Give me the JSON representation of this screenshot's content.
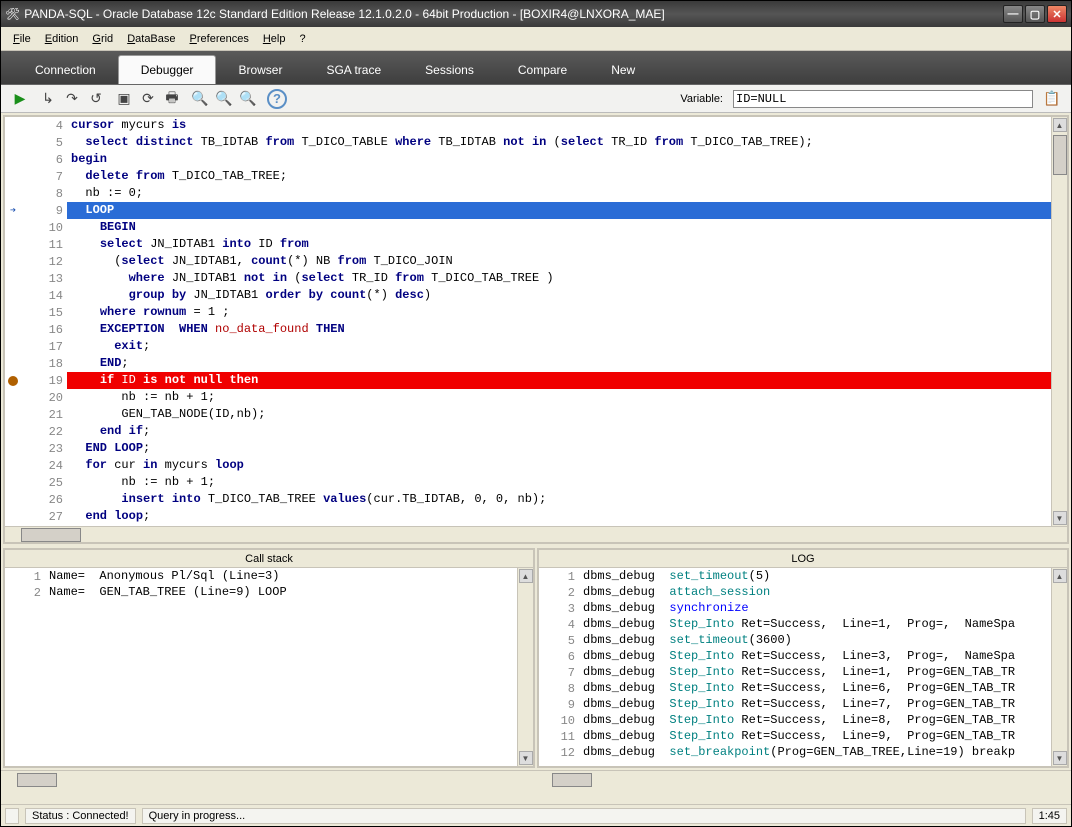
{
  "title": "PANDA-SQL - Oracle Database 12c Standard Edition Release 12.1.0.2.0 - 64bit Production - [BOXIR4@LNXORA_MAE]",
  "menu": {
    "file": "File",
    "edition": "Edition",
    "grid": "Grid",
    "database": "DataBase",
    "preferences": "Preferences",
    "help": "Help",
    "q": "?"
  },
  "tabs": {
    "connection": "Connection",
    "debugger": "Debugger",
    "browser": "Browser",
    "sga": "SGA trace",
    "sessions": "Sessions",
    "compare": "Compare",
    "new": "New"
  },
  "toolbar": {
    "variable_label": "Variable:",
    "variable_value": "ID=NULL"
  },
  "code": [
    {
      "n": 4,
      "html": "<span class='kw'>cursor</span> mycurs <span class='kw'>is</span>"
    },
    {
      "n": 5,
      "html": "  <span class='kw'>select</span> <span class='kw'>distinct</span> TB_IDTAB <span class='kw'>from</span> T_DICO_TABLE <span class='kw'>where</span> TB_IDTAB <span class='kw'>not</span> <span class='kw'>in</span> (<span class='kw'>select</span> TR_ID <span class='kw'>from</span> T_DICO_TAB_TREE);"
    },
    {
      "n": 6,
      "html": "<span class='kw'>begin</span>"
    },
    {
      "n": 7,
      "html": "  <span class='kw'>delete</span> <span class='kw'>from</span> T_DICO_TAB_TREE;"
    },
    {
      "n": 8,
      "html": "  nb := 0;"
    },
    {
      "n": 9,
      "mark": "arrow",
      "cls": "hl-blue",
      "html": "  <span class='kw'>LOOP</span>"
    },
    {
      "n": 10,
      "html": "    <span class='kw'>BEGIN</span>"
    },
    {
      "n": 11,
      "html": "    <span class='kw'>select</span> JN_IDTAB1 <span class='kw'>into</span> ID <span class='kw'>from</span>"
    },
    {
      "n": 12,
      "html": "      (<span class='kw'>select</span> JN_IDTAB1, <span class='kw'>count</span>(*) NB <span class='kw'>from</span> T_DICO_JOIN"
    },
    {
      "n": 13,
      "html": "        <span class='kw'>where</span> JN_IDTAB1 <span class='kw'>not</span> <span class='kw'>in</span> (<span class='kw'>select</span> TR_ID <span class='kw'>from</span> T_DICO_TAB_TREE )"
    },
    {
      "n": 14,
      "html": "        <span class='kw'>group</span> <span class='kw'>by</span> JN_IDTAB1 <span class='kw'>order</span> <span class='kw'>by</span> <span class='kw'>count</span>(*) <span class='kw'>desc</span>)"
    },
    {
      "n": 15,
      "html": "    <span class='kw'>where</span> <span class='kw'>rownum</span> = 1 ;"
    },
    {
      "n": 16,
      "html": "    <span class='kw'>EXCEPTION</span>  <span class='kw'>WHEN</span> <span class='red'>no_data_found</span> <span class='kw'>THEN</span>"
    },
    {
      "n": 17,
      "html": "      <span class='kw'>exit</span>;"
    },
    {
      "n": 18,
      "html": "    <span class='kw'>END</span>;"
    },
    {
      "n": 19,
      "mark": "bp",
      "cls": "hl-red",
      "html": "    <span class='kw'>if</span> ID <span class='kw'>is</span> <span class='kw'>not</span> <span class='kw'>null</span> <span class='kw'>then</span>"
    },
    {
      "n": 20,
      "html": "       nb := nb + 1;"
    },
    {
      "n": 21,
      "html": "       GEN_TAB_NODE(ID,nb);"
    },
    {
      "n": 22,
      "html": "    <span class='kw'>end</span> <span class='kw'>if</span>;"
    },
    {
      "n": 23,
      "html": "  <span class='kw'>END</span> <span class='kw'>LOOP</span>;"
    },
    {
      "n": 24,
      "html": "  <span class='kw'>for</span> cur <span class='kw'>in</span> mycurs <span class='kw'>loop</span>"
    },
    {
      "n": 25,
      "html": "       nb := nb + 1;"
    },
    {
      "n": 26,
      "html": "       <span class='kw'>insert</span> <span class='kw'>into</span> T_DICO_TAB_TREE <span class='kw'>values</span>(cur.TB_IDTAB, 0, 0, nb);"
    },
    {
      "n": 27,
      "html": "  <span class='kw'>end</span> <span class='kw'>loop</span>;"
    }
  ],
  "callstack": {
    "title": "Call stack",
    "rows": [
      {
        "n": 1,
        "text": "Name=  Anonymous Pl/Sql (Line=3)"
      },
      {
        "n": 2,
        "text": "Name=  GEN_TAB_TREE (Line=9) LOOP"
      }
    ]
  },
  "log": {
    "title": "LOG",
    "rows": [
      {
        "n": 1,
        "html": "dbms_debug  <span class='op'>set_timeout</span>(5)"
      },
      {
        "n": 2,
        "html": "dbms_debug  <span class='op'>attach_session</span>"
      },
      {
        "n": 3,
        "html": "dbms_debug  <a>synchronize</a>"
      },
      {
        "n": 4,
        "html": "dbms_debug  <span class='op'>Step_Into</span> Ret=Success,  Line=1,  Prog=,  NameSpa"
      },
      {
        "n": 5,
        "html": "dbms_debug  <span class='op'>set_timeout</span>(3600)"
      },
      {
        "n": 6,
        "html": "dbms_debug  <span class='op'>Step_Into</span> Ret=Success,  Line=3,  Prog=,  NameSpa"
      },
      {
        "n": 7,
        "html": "dbms_debug  <span class='op'>Step_Into</span> Ret=Success,  Line=1,  Prog=GEN_TAB_TR"
      },
      {
        "n": 8,
        "html": "dbms_debug  <span class='op'>Step_Into</span> Ret=Success,  Line=6,  Prog=GEN_TAB_TR"
      },
      {
        "n": 9,
        "html": "dbms_debug  <span class='op'>Step_Into</span> Ret=Success,  Line=7,  Prog=GEN_TAB_TR"
      },
      {
        "n": 10,
        "html": "dbms_debug  <span class='op'>Step_Into</span> Ret=Success,  Line=8,  Prog=GEN_TAB_TR"
      },
      {
        "n": 11,
        "html": "dbms_debug  <span class='op'>Step_Into</span> Ret=Success,  Line=9,  Prog=GEN_TAB_TR"
      },
      {
        "n": 12,
        "html": "dbms_debug  <span class='op'>set_breakpoint</span>(Prog=GEN_TAB_TREE,Line=19) breakp"
      }
    ]
  },
  "status": {
    "connected": "Status : Connected!",
    "query": "Query in progress...",
    "time": "1:45"
  }
}
